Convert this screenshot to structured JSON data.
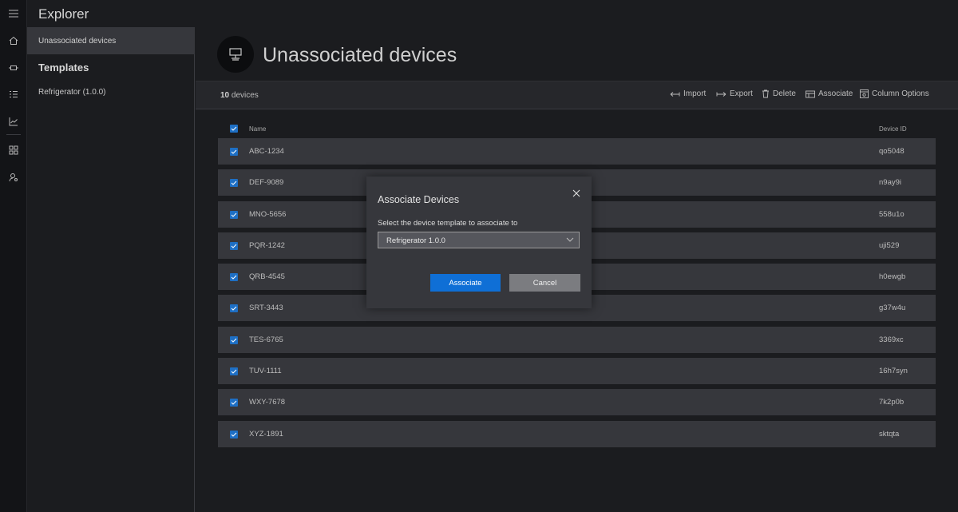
{
  "app": {
    "title": "Explorer"
  },
  "rail": {
    "icons": [
      "hamburger-icon",
      "home-icon",
      "device-icon",
      "rules-icon",
      "analytics-icon",
      "dashboard-icon",
      "user-settings-icon"
    ]
  },
  "explorer": {
    "active_item": "Unassociated devices",
    "templates_heading": "Templates",
    "templates": [
      {
        "label": "Refrigerator (1.0.0)"
      }
    ]
  },
  "main": {
    "title": "Unassociated devices",
    "toolbar": {
      "count_number": "10",
      "count_suffix": " devices",
      "import_label": "Import",
      "export_label": "Export",
      "delete_label": "Delete",
      "associate_label": "Associate",
      "column_options_label": "Column Options"
    },
    "table": {
      "columns": {
        "name": "Name",
        "device_id": "Device ID"
      },
      "rows": [
        {
          "name": "ABC-1234",
          "device_id": "qo5048",
          "checked": true
        },
        {
          "name": "DEF-9089",
          "device_id": "n9ay9i",
          "checked": true
        },
        {
          "name": "MNO-5656",
          "device_id": "558u1o",
          "checked": true
        },
        {
          "name": "PQR-1242",
          "device_id": "uji529",
          "checked": true
        },
        {
          "name": "QRB-4545",
          "device_id": "h0ewgb",
          "checked": true
        },
        {
          "name": "SRT-3443",
          "device_id": "g37w4u",
          "checked": true
        },
        {
          "name": "TES-6765",
          "device_id": "3369xc",
          "checked": true
        },
        {
          "name": "TUV-1111",
          "device_id": "16h7syn",
          "checked": true
        },
        {
          "name": "WXY-7678",
          "device_id": "7k2p0b",
          "checked": true
        },
        {
          "name": "XYZ-1891",
          "device_id": "sktqta",
          "checked": true
        }
      ]
    }
  },
  "modal": {
    "title": "Associate Devices",
    "label": "Select the device template to associate to",
    "selected_template": "Refrigerator 1.0.0",
    "associate_button": "Associate",
    "cancel_button": "Cancel"
  },
  "colors": {
    "accent": "#0f6fd6",
    "checkbox": "#1e6fc4",
    "row_bg": "#36373c",
    "page_bg": "#1b1c1f"
  }
}
